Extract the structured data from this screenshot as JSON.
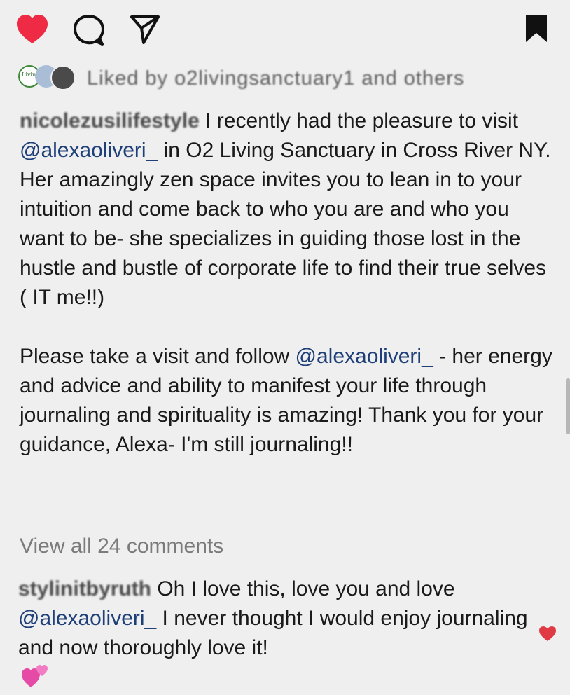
{
  "actions": {
    "like_icon": "heart-filled-icon",
    "comment_icon": "comment-icon",
    "share_icon": "send-icon",
    "save_icon": "bookmark-icon",
    "like_color": "#ee2a45"
  },
  "likes": {
    "avatar1_text": "Living",
    "text": "Liked by o2livingsanctuary1 and others"
  },
  "caption": {
    "username": "nicolezusilifestyle",
    "p1_a": " I recently had the pleasure to visit ",
    "mention1": "@alexaoliveri_",
    "p1_b": " in O2 Living Sanctuary in Cross River NY. Her amazingly zen space invites you to lean in to your intuition and come back to who you are and who you want to be- she specializes in guiding those lost in the hustle and bustle of corporate life to find their true selves ( IT me!!)",
    "p2_a": "Please take a visit  and follow ",
    "mention2": "@alexaoliveri_",
    "p2_b": " - her energy and advice and ability to manifest your life through journaling and spirituality is amazing! Thank you for your guidance, Alexa- I'm still journaling!!"
  },
  "view_all": "View all 24 comments",
  "comment": {
    "username": "stylinitbyruth",
    "text_a": " Oh I love this, love you and love ",
    "mention": "@alexaoliveri_",
    "text_b": " I never thought I would enjoy journaling and now thoroughly love it!",
    "emoji": "💕",
    "like_icon": "heart-small-icon"
  }
}
